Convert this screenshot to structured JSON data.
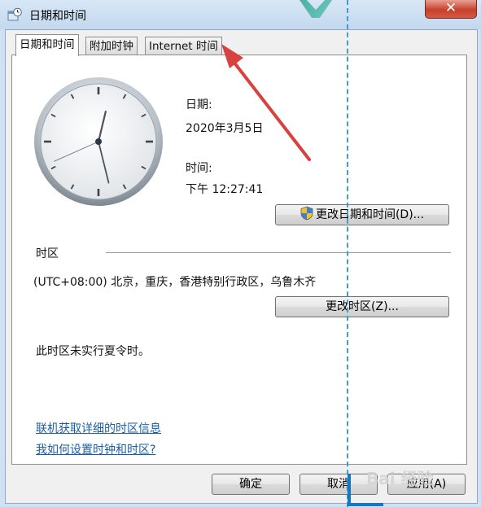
{
  "window": {
    "title": "日期和时间",
    "close_label": "✕"
  },
  "tabs": [
    {
      "label": "日期和时间"
    },
    {
      "label": "附加时钟"
    },
    {
      "label": "Internet 时间"
    }
  ],
  "datetime": {
    "date_label": "日期:",
    "date_value": "2020年3月5日",
    "time_label": "时间:",
    "time_value": "下午 12:27:41",
    "change_button": "更改日期和时间(D)..."
  },
  "timezone": {
    "section_label": "时区",
    "value": "(UTC+08:00) 北京，重庆，香港特别行政区，乌鲁木齐",
    "change_button": "更改时区(Z)...",
    "dst_note": "此时区未实行夏令时。"
  },
  "links": {
    "online_info": "联机获取详细的时区信息",
    "how_to": "我如何设置时钟和时区?"
  },
  "footer": {
    "ok": "确定",
    "cancel": "取消",
    "apply": "应用(A)"
  },
  "clock": {
    "hour": 12,
    "minute": 27,
    "second": 41
  },
  "colors": {
    "link": "#1b5ea8",
    "annotation_arrow": "#d94040",
    "guide_line": "#3aa0cf"
  },
  "icons": {
    "title": "datetime-app-icon",
    "uac": "uac-shield-icon"
  }
}
